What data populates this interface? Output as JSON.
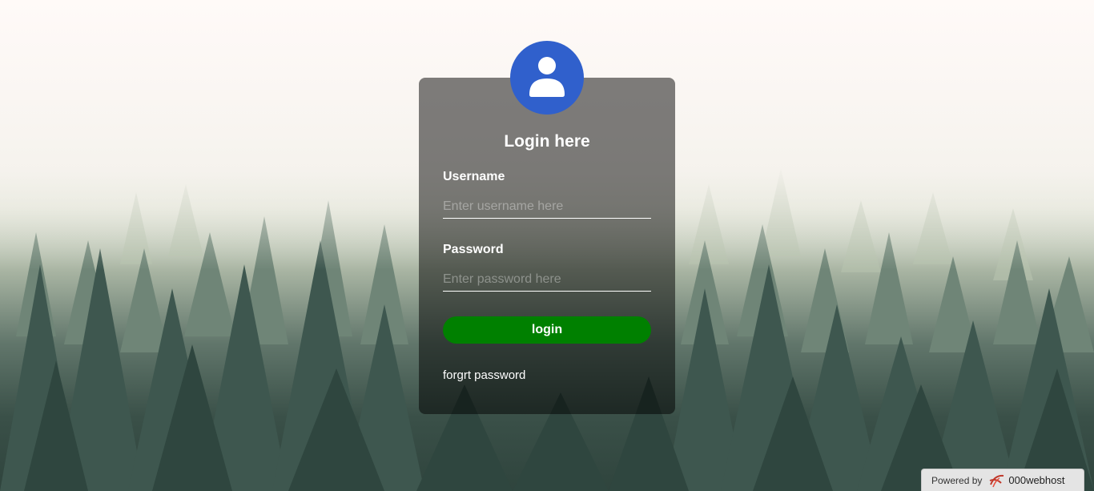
{
  "login": {
    "title": "Login here",
    "username_label": "Username",
    "username_placeholder": "Enter username here",
    "password_label": "Password",
    "password_placeholder": "Enter password here",
    "login_button": "login",
    "forgot_link": "forgrt password"
  },
  "footer": {
    "powered_by": "Powered by",
    "brand": "000webhost"
  },
  "colors": {
    "avatar": "#3060cc",
    "login_button": "#008000",
    "card_overlay": "rgba(0,0,0,0.5)"
  },
  "icons": {
    "avatar": "user-avatar-icon",
    "host_logo": "000webhost-logo"
  }
}
